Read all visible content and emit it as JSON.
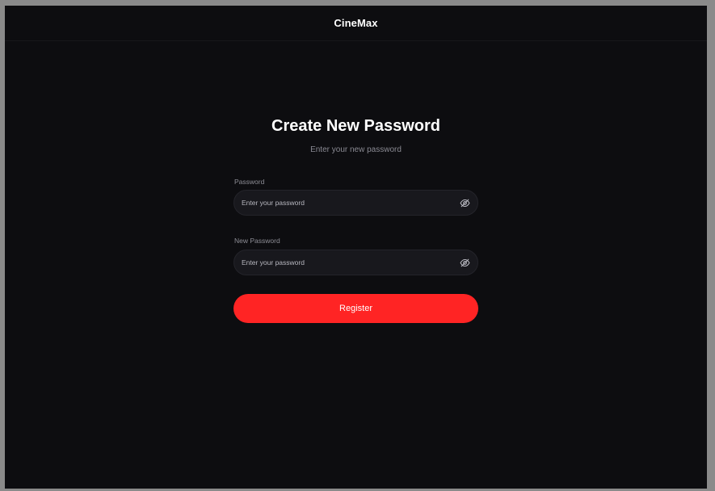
{
  "header": {
    "brand": "CineMax"
  },
  "form": {
    "title": "Create New Password",
    "subtitle": "Enter your new password",
    "fields": [
      {
        "label": "Password",
        "placeholder": "Enter your password",
        "value": "",
        "toggle_icon": "eye-off-icon"
      },
      {
        "label": "New Password",
        "placeholder": "Enter your password",
        "value": "",
        "toggle_icon": "eye-off-icon"
      }
    ],
    "submit_label": "Register"
  },
  "colors": {
    "background": "#0d0d10",
    "input_background": "#18181d",
    "accent": "#ff2424",
    "text_primary": "#ffffff",
    "text_muted": "#8a8a93"
  }
}
